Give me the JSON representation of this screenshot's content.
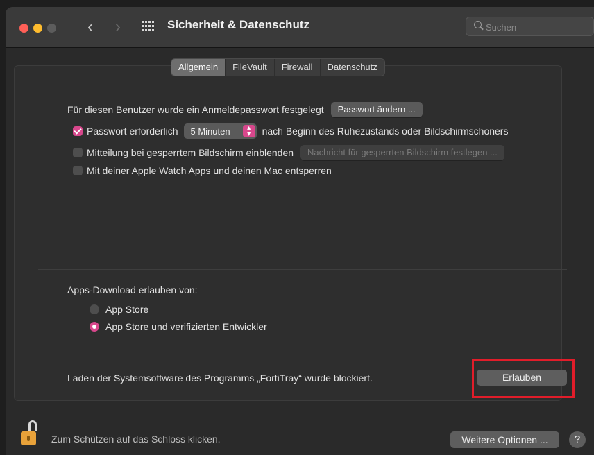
{
  "window": {
    "title": "Sicherheit & Datenschutz"
  },
  "search": {
    "placeholder": "Suchen"
  },
  "tabs": [
    {
      "label": "Allgemein",
      "active": true
    },
    {
      "label": "FileVault",
      "active": false
    },
    {
      "label": "Firewall",
      "active": false
    },
    {
      "label": "Datenschutz",
      "active": false
    }
  ],
  "general": {
    "password_text": "Für diesen Benutzer wurde ein Anmeldepasswort festgelegt",
    "change_password_button": "Passwort ändern ...",
    "require_password_label": "Passwort erforderlich",
    "require_password_checked": true,
    "require_password_delay": "5 Minuten",
    "require_password_suffix": "nach Beginn des Ruhezustands oder Bildschirmschoners",
    "lock_message_label": "Mitteilung bei gesperrtem Bildschirm einblenden",
    "lock_message_checked": false,
    "lock_message_button": "Nachricht für gesperrten Bildschirm festlegen ...",
    "apple_watch_label": "Mit deiner Apple Watch Apps und deinen Mac entsperren",
    "apple_watch_checked": false
  },
  "downloads": {
    "heading": "Apps-Download erlauben von:",
    "options": [
      {
        "label": "App Store",
        "selected": false
      },
      {
        "label": "App Store und verifizierten Entwickler",
        "selected": true
      }
    ]
  },
  "blocked": {
    "message": "Laden der Systemsoftware des Programms „FortiTray“ wurde blockiert.",
    "allow_button": "Erlauben"
  },
  "footer": {
    "lock_text": "Zum Schützen auf das Schloss klicken.",
    "more_options_button": "Weitere Optionen ...",
    "help_button": "?"
  },
  "colors": {
    "accent": "#d8478c",
    "highlight": "#e11d2a"
  }
}
